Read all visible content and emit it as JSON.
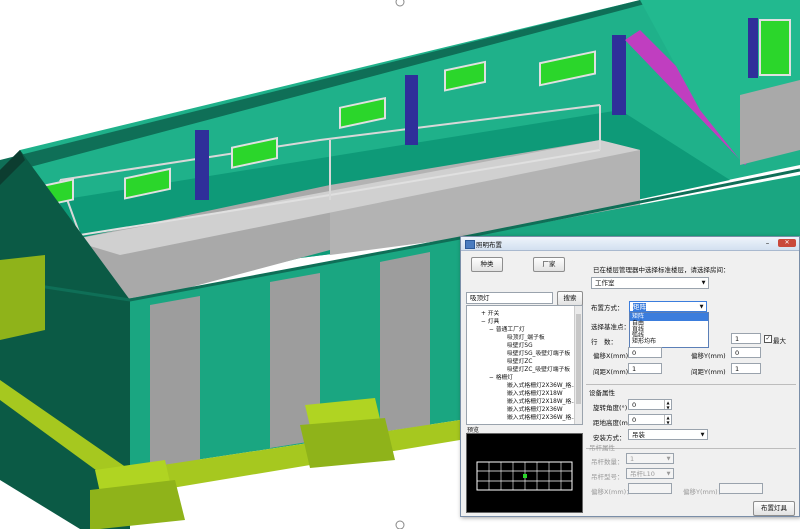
{
  "window": {
    "title": "照明布置"
  },
  "left": {
    "btn_category": "种类",
    "btn_vendor": "厂家",
    "search_value": "吸顶灯",
    "btn_search": "搜索",
    "tree": [
      {
        "toggle": "+",
        "label": "开关"
      },
      {
        "toggle": "−",
        "label": "灯具"
      },
      {
        "toggle": "−",
        "label": "普通工厂灯"
      },
      {
        "toggle": "",
        "label": "吸顶灯_端子板"
      },
      {
        "toggle": "",
        "label": "吸壁灯SG"
      },
      {
        "toggle": "",
        "label": "吸壁灯SG_吸壁灯端子板"
      },
      {
        "toggle": "",
        "label": "吸壁灯ZC"
      },
      {
        "toggle": "",
        "label": "吸壁灯ZC_吸壁灯端子板"
      },
      {
        "toggle": "−",
        "label": "格栅灯"
      },
      {
        "toggle": "",
        "label": "嵌入式格栅灯2X36W_格..."
      },
      {
        "toggle": "",
        "label": "嵌入式格栅灯2X18W"
      },
      {
        "toggle": "",
        "label": "嵌入式格栅灯2X18W_格..."
      },
      {
        "toggle": "",
        "label": "嵌入式格栅灯2X36W"
      },
      {
        "toggle": "",
        "label": "嵌入式格栅灯2X36W_格..."
      }
    ],
    "preview_label": "预览"
  },
  "right": {
    "instruction": "已在楼层管理器中选择标准楼层，请选择房间：",
    "room_value": "工作室",
    "layout_label": "布置方式：",
    "layout_value": "矩阵",
    "layout_options": [
      "矩阵",
      "自由",
      "直线",
      "弧线",
      "矩形均布"
    ],
    "base_point_label": "选择基准点：",
    "rows_label": "行　数：",
    "cols_value": "1",
    "max_label": "最大",
    "offset_x_label": "偏移X(mm)",
    "offset_x_value": "0",
    "offset_y_label": "偏移Y(mm)",
    "offset_y_value": "0",
    "spacing_x_label": "间距X(mm)",
    "spacing_x_value": "1",
    "spacing_y_label": "间距Y(mm)",
    "spacing_y_value": "1",
    "device_section": "设备属性",
    "rotation_label": "旋转角度(°)",
    "rotation_value": "0",
    "height_label": "距地高度(m)",
    "height_value": "0",
    "install_label": "安装方式：",
    "install_value": "吊装",
    "hang_section": "吊杆属性",
    "hang_count_label": "吊杆数量：",
    "hang_count_value": "1",
    "hang_model_label": "吊杆型号：",
    "hang_model_value": "吊杆L10",
    "hang_offset_x_label": "偏移X(mm)：",
    "hang_offset_y_label": "偏移Y(mm)：",
    "place_button": "布置灯具"
  }
}
